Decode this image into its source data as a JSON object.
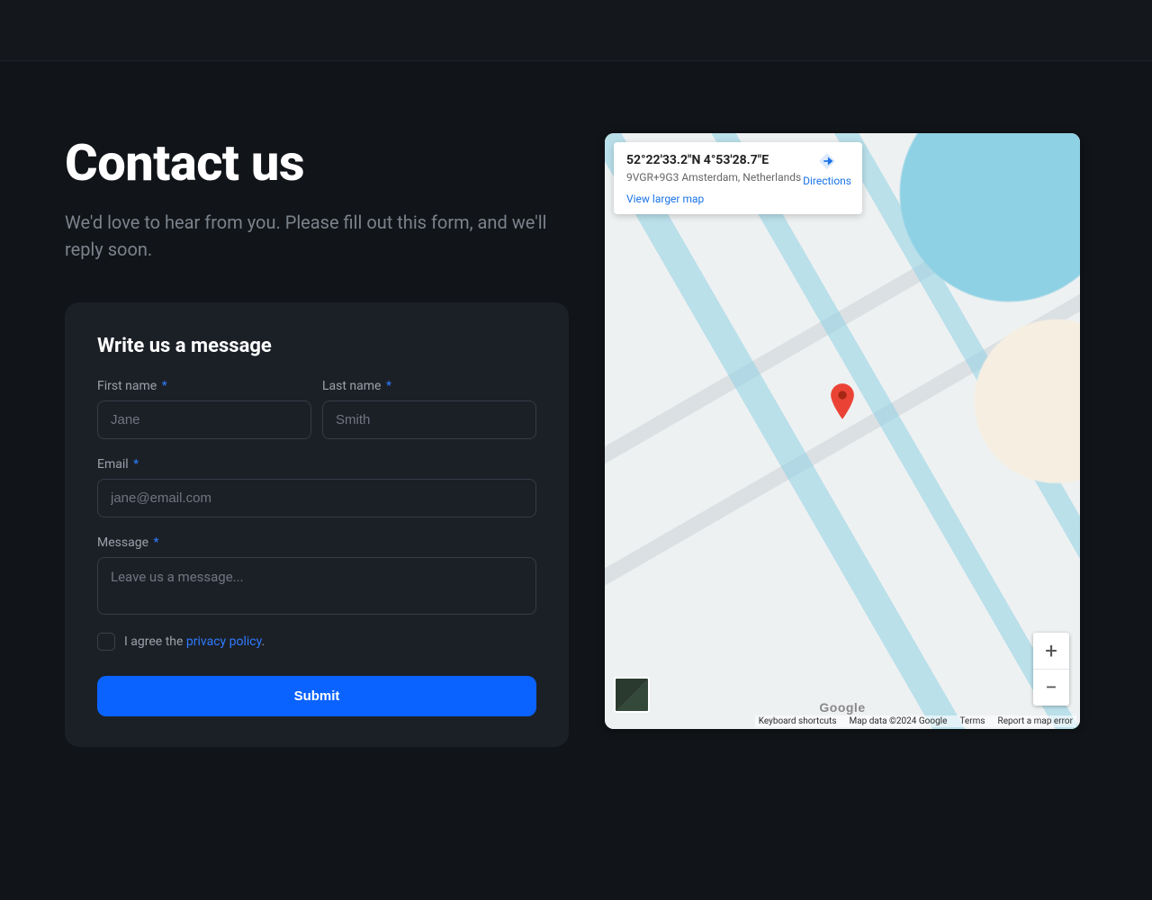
{
  "header": {
    "title": "Contact us",
    "subtitle": "We'd love to hear from you. Please fill out this form, and we'll reply soon."
  },
  "form": {
    "title": "Write us a message",
    "first_name": {
      "label": "First name",
      "placeholder": "Jane"
    },
    "last_name": {
      "label": "Last name",
      "placeholder": "Smith"
    },
    "email": {
      "label": "Email",
      "placeholder": "jane@email.com"
    },
    "message": {
      "label": "Message",
      "placeholder": "Leave us a message..."
    },
    "required_marker": "*",
    "consent_prefix": "I agree the ",
    "consent_link": "privacy policy",
    "consent_suffix": ".",
    "submit": "Submit"
  },
  "map": {
    "coords": "52°22'33.2\"N 4°53'28.7\"E",
    "address": "9VGR+9G3 Amsterdam, Netherlands",
    "view_larger": "View larger map",
    "directions": "Directions",
    "logo": "Google",
    "footer": {
      "shortcuts": "Keyboard shortcuts",
      "mapdata": "Map data ©2024 Google",
      "terms": "Terms",
      "report": "Report a map error"
    },
    "zoom": {
      "plus": "+",
      "minus": "−"
    }
  },
  "colors": {
    "accent": "#0a63ff",
    "link": "#2f7bff"
  }
}
